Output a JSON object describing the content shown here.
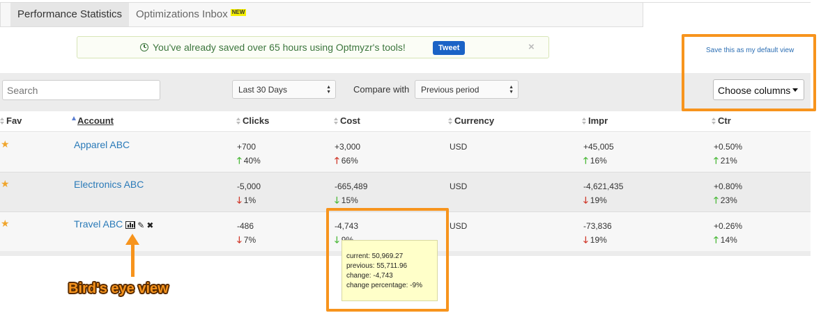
{
  "tabs": [
    {
      "label": "Performance Statistics",
      "active": true
    },
    {
      "label": "Optimizations Inbox",
      "badge": "NEW",
      "active": false
    }
  ],
  "notice": {
    "message": "You've already saved over 65 hours using Optmyzr's tools!",
    "tweet_label": "Tweet",
    "close_label": "×"
  },
  "default_view_link": "Save this as my default view",
  "filters": {
    "search_placeholder": "Search",
    "date_range": "Last 30 Days",
    "compare_label": "Compare with",
    "compare_value": "Previous period",
    "choose_columns": "Choose columns"
  },
  "table": {
    "headers": {
      "fav": "Fav",
      "account": "Account",
      "clicks": "Clicks",
      "cost": "Cost",
      "currency": "Currency",
      "impr": "Impr",
      "ctr": "Ctr"
    },
    "rows": [
      {
        "account": "Apparel ABC",
        "clicks": "+700",
        "clicks_pct": "40%",
        "clicks_dir": "up",
        "cost": "+3,000",
        "cost_pct": "66%",
        "cost_dir": "up-red",
        "currency": "USD",
        "impr": "+45,005",
        "impr_pct": "16%",
        "impr_dir": "up",
        "ctr": "+0.50%",
        "ctr_pct": "21%",
        "ctr_dir": "up"
      },
      {
        "account": "Electronics ABC",
        "clicks": "-5,000",
        "clicks_pct": "1%",
        "clicks_dir": "down",
        "cost": "-665,489",
        "cost_pct": "15%",
        "cost_dir": "down-green",
        "currency": "USD",
        "impr": "-4,621,435",
        "impr_pct": "19%",
        "impr_dir": "down",
        "ctr": "+0.80%",
        "ctr_pct": "23%",
        "ctr_dir": "up"
      },
      {
        "account": "Travel ABC",
        "clicks": "-486",
        "clicks_pct": "7%",
        "clicks_dir": "down",
        "cost": "-4,743",
        "cost_pct": "9%",
        "cost_dir": "down-green",
        "currency": "USD",
        "impr": "-73,836",
        "impr_pct": "19%",
        "impr_dir": "down",
        "ctr": "+0.26%",
        "ctr_pct": "14%",
        "ctr_dir": "up"
      }
    ]
  },
  "tooltip": {
    "current": "current: 50,969.27",
    "previous": "previous: 55,711.96",
    "change": "change: -4,743",
    "change_percentage": "change percentage: -9%"
  },
  "annotation_label": "Bird's eye view",
  "colors": {
    "accent_orange": "#f7941d",
    "link_blue": "#2a7ab8",
    "up_green": "#4cb93a",
    "down_red": "#d0392b",
    "star": "#f0a52c"
  }
}
